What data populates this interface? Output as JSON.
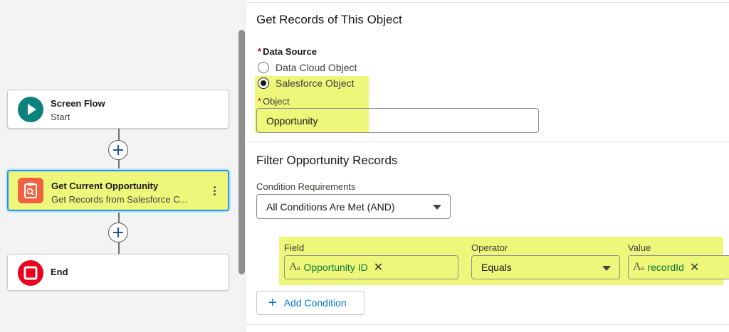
{
  "canvas": {
    "start_node": {
      "title": "Screen Flow",
      "subtitle": "Start",
      "icon": "play-icon"
    },
    "get_node": {
      "title": "Get Current Opportunity",
      "subtitle": "Get Records from Salesforce C...",
      "icon": "clipboard-search-icon",
      "menu_icon": "kebab-menu-icon"
    },
    "end_node": {
      "title": "End",
      "icon": "stop-icon"
    },
    "add_icon": "plus-circle-icon"
  },
  "panel": {
    "section1_title": "Get Records of This Object",
    "data_source": {
      "required_mark": "*",
      "label": "Data Source",
      "options": [
        "Data Cloud Object",
        "Salesforce Object"
      ],
      "selected": "Salesforce Object"
    },
    "object": {
      "required_mark": "*",
      "label": "Object",
      "value": "Opportunity"
    },
    "section2_title": "Filter Opportunity Records",
    "condition_requirements": {
      "label": "Condition Requirements",
      "value": "All Conditions Are Met (AND)"
    },
    "condition": {
      "field_label": "Field",
      "field_value": "Opportunity ID",
      "operator_label": "Operator",
      "operator_value": "Equals",
      "value_label": "Value",
      "value_value": "recordId",
      "clear_glyph": "✕",
      "aa_glyph": "A",
      "aa_small": "a"
    },
    "add_condition_plus": "+",
    "add_condition_label": "Add Condition"
  },
  "colors": {
    "highlight": "#eef77a",
    "start_icon": "#0b827c",
    "get_icon": "#f0613f",
    "end_icon": "#ea001e",
    "selection_border": "#1b96ff",
    "link": "#0176d3",
    "merge_field_text": "#0b7a3a"
  }
}
